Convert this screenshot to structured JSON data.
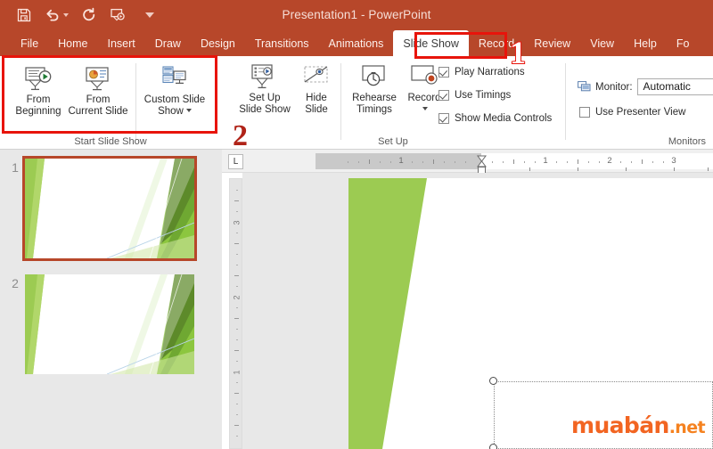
{
  "window": {
    "title": "Presentation1  -  PowerPoint",
    "accent_color": "#b7472a",
    "annotation_color": "#e8140b"
  },
  "quick_access": {
    "items": [
      {
        "name": "save-icon",
        "label": "Save"
      },
      {
        "name": "undo-icon",
        "label": "Undo"
      },
      {
        "name": "redo-icon",
        "label": "Redo"
      },
      {
        "name": "start-from-beginning-icon",
        "label": "Start From Beginning"
      },
      {
        "name": "customize-quick-access-icon",
        "label": "Customize Quick Access Toolbar"
      }
    ]
  },
  "ribbon": {
    "tabs": [
      {
        "label": "File",
        "active": false
      },
      {
        "label": "Home",
        "active": false
      },
      {
        "label": "Insert",
        "active": false
      },
      {
        "label": "Draw",
        "active": false
      },
      {
        "label": "Design",
        "active": false
      },
      {
        "label": "Transitions",
        "active": false
      },
      {
        "label": "Animations",
        "active": false
      },
      {
        "label": "Slide Show",
        "active": true
      },
      {
        "label": "Record",
        "active": false
      },
      {
        "label": "Review",
        "active": false
      },
      {
        "label": "View",
        "active": false
      },
      {
        "label": "Help",
        "active": false
      },
      {
        "label": "Fo",
        "active": false
      }
    ],
    "groups": {
      "start_slide_show": {
        "label": "Start Slide Show",
        "buttons": [
          {
            "line1": "From",
            "line2": "Beginning",
            "icon": "from-beginning-icon",
            "has_dropdown": false
          },
          {
            "line1": "From",
            "line2": "Current Slide",
            "icon": "from-current-slide-icon",
            "has_dropdown": false
          },
          {
            "line1": "Custom Slide",
            "line2": "Show",
            "icon": "custom-slide-show-icon",
            "has_dropdown": true
          }
        ]
      },
      "set_up": {
        "label": "Set Up",
        "buttons": [
          {
            "line1": "Set Up",
            "line2": "Slide Show",
            "icon": "set-up-slide-show-icon",
            "has_dropdown": false
          },
          {
            "line1": "Hide",
            "line2": "Slide",
            "icon": "hide-slide-icon",
            "has_dropdown": false
          },
          {
            "line1": "Rehearse",
            "line2": "Timings",
            "icon": "rehearse-timings-icon",
            "has_dropdown": false
          },
          {
            "line1": "Record",
            "line2": "",
            "icon": "record-icon",
            "has_dropdown": true
          }
        ],
        "checkboxes": [
          {
            "label": "Play Narrations",
            "checked": true
          },
          {
            "label": "Use Timings",
            "checked": true
          },
          {
            "label": "Show Media Controls",
            "checked": true
          }
        ]
      },
      "monitors": {
        "label": "Monitors",
        "monitor_label": "Monitor:",
        "monitor_value": "Automatic",
        "monitor_icon": "monitor-icon",
        "presenter_view": {
          "label": "Use Presenter View",
          "checked": false
        }
      }
    }
  },
  "annotations": [
    {
      "id": "1",
      "target": "slide-show-tab"
    },
    {
      "id": "2",
      "target": "start-slide-show-group"
    }
  ],
  "thumbnails": {
    "slides": [
      {
        "number": "1",
        "selected": true
      },
      {
        "number": "2",
        "selected": false
      }
    ]
  },
  "rulers": {
    "horizontal_labels": [
      "1",
      "1",
      "2",
      "3"
    ],
    "vertical_labels": [
      "3",
      "2",
      "1"
    ],
    "tab_stop_glyph": "L"
  },
  "canvas": {
    "selection": {
      "visible": true,
      "handles": 2
    },
    "watermark": {
      "main": "muabán",
      "suffix": ".net",
      "color": "#f26522"
    }
  }
}
